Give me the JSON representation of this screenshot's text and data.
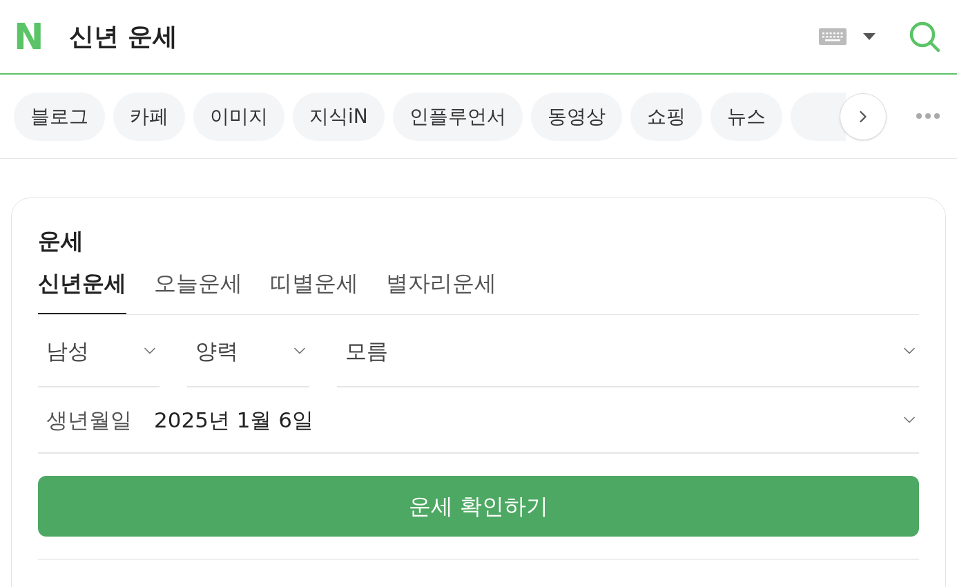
{
  "header": {
    "logo": "N",
    "title": "신년 운세"
  },
  "chips": [
    {
      "label": "블로그"
    },
    {
      "label": "카페"
    },
    {
      "label": "이미지"
    },
    {
      "label": "지식iN"
    },
    {
      "label": "인플루언서"
    },
    {
      "label": "동영상"
    },
    {
      "label": "쇼핑"
    },
    {
      "label": "뉴스"
    }
  ],
  "card": {
    "title": "운세",
    "tabs": [
      {
        "label": "신년운세",
        "selected": true
      },
      {
        "label": "오늘운세",
        "selected": false
      },
      {
        "label": "띠별운세",
        "selected": false
      },
      {
        "label": "별자리운세",
        "selected": false
      }
    ],
    "selects": [
      {
        "value": "남성"
      },
      {
        "value": "양력"
      },
      {
        "value": "모름"
      }
    ],
    "birth": {
      "label": "생년월일",
      "value": "2025년 1월 6일"
    },
    "button": "운세 확인하기"
  }
}
